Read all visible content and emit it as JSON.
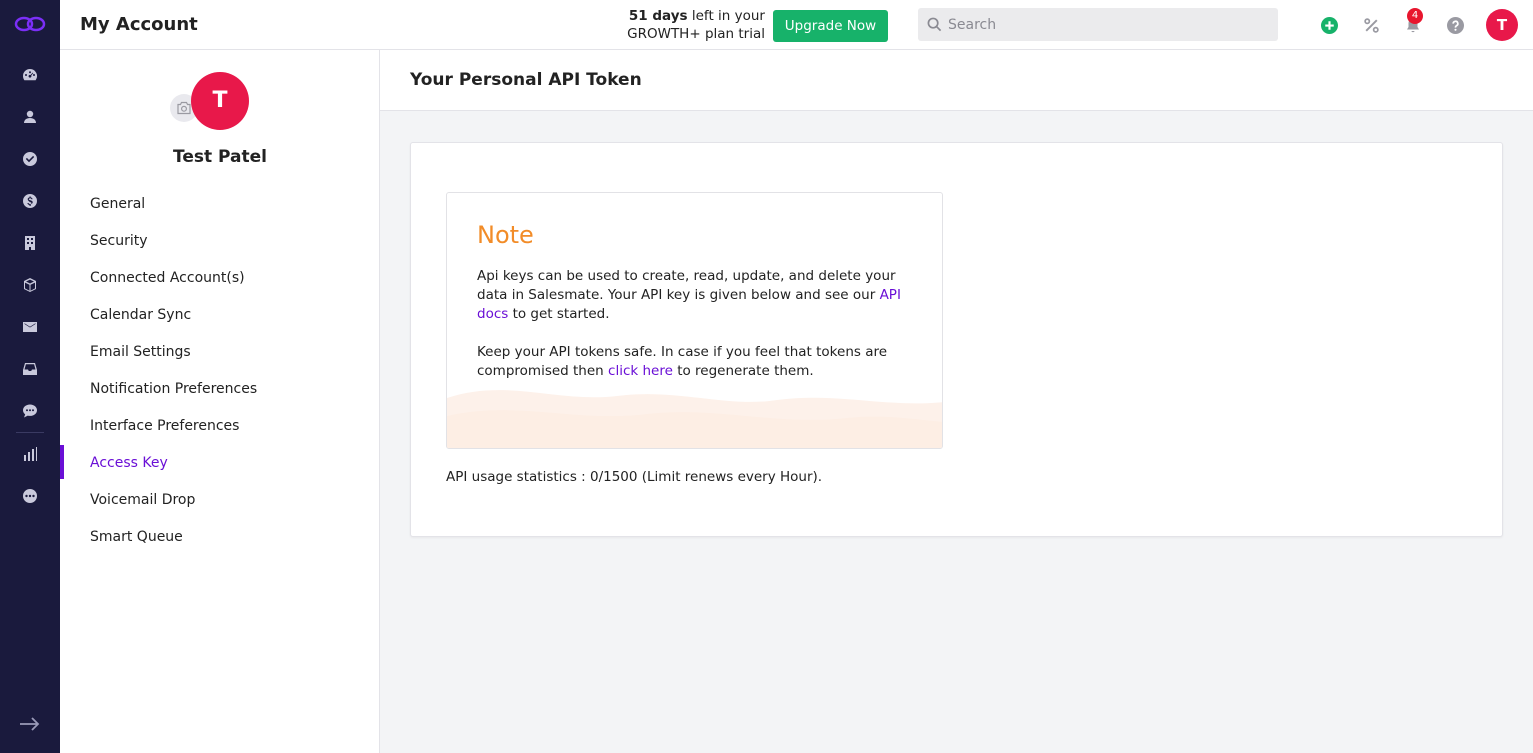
{
  "header": {
    "title": "My Account",
    "trial_days": "51 days",
    "trial_text_1": "left in your",
    "trial_text_2": "GROWTH+ plan trial",
    "upgrade_label": "Upgrade Now",
    "search_placeholder": "Search",
    "notification_count": "4",
    "avatar_initial": "T"
  },
  "rail": {
    "items": [
      "dashboard-icon",
      "contacts-icon",
      "tasks-icon",
      "deals-icon",
      "companies-icon",
      "products-icon",
      "email-icon",
      "inbox-icon",
      "chat-icon",
      "reports-icon",
      "more-icon"
    ]
  },
  "profile": {
    "initial": "T",
    "name": "Test Patel"
  },
  "sidebar": {
    "items": [
      {
        "label": "General"
      },
      {
        "label": "Security"
      },
      {
        "label": "Connected Account(s)"
      },
      {
        "label": "Calendar Sync"
      },
      {
        "label": "Email Settings"
      },
      {
        "label": "Notification Preferences"
      },
      {
        "label": "Interface Preferences"
      },
      {
        "label": "Access Key",
        "active": true
      },
      {
        "label": "Voicemail Drop"
      },
      {
        "label": "Smart Queue"
      }
    ]
  },
  "main": {
    "title": "Your Personal API Token",
    "note": {
      "heading": "Note",
      "p1_before": "Api keys can be used to create, read, update, and delete your data in Salesmate. Your API key is given below and see our ",
      "p1_link": "API docs",
      "p1_after": " to get started.",
      "p2_before": "Keep your API tokens safe. In case if you feel that tokens are compromised then ",
      "p2_link": "click here",
      "p2_after": " to regenerate them."
    },
    "usage": "API usage statistics : 0/1500 (Limit renews every Hour)."
  },
  "colors": {
    "rail_bg": "#1a1a3d",
    "accent": "#6a0fd6",
    "upgrade": "#17b26a",
    "avatar": "#e8184a",
    "note_heading": "#f28c28"
  }
}
